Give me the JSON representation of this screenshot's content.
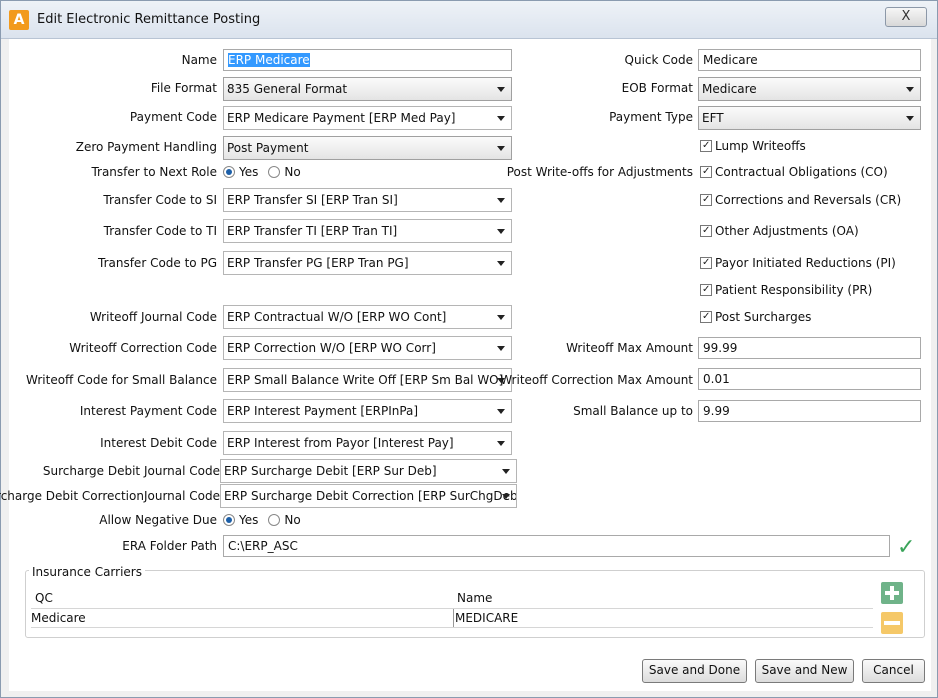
{
  "window": {
    "title": "Edit Electronic Remittance Posting",
    "close_label": "X"
  },
  "labels": {
    "name": "Name",
    "file_format": "File Format",
    "payment_code": "Payment Code",
    "zero_payment": "Zero Payment Handling",
    "transfer_next_role": "Transfer to Next Role",
    "transfer_si": "Transfer Code to SI",
    "transfer_ti": "Transfer Code to TI",
    "transfer_pg": "Transfer Code to PG",
    "writeoff_journal": "Writeoff Journal Code",
    "writeoff_correction": "Writeoff Correction Code",
    "writeoff_small": "Writeoff Code for Small Balance",
    "interest_payment": "Interest Payment Code",
    "interest_debit": "Interest Debit Code",
    "surcharge_debit": "Surcharge Debit Journal Code",
    "surcharge_correction": "Surcharge Debit CorrectionJournal Code",
    "allow_negative": "Allow Negative Due",
    "era_folder": "ERA Folder Path",
    "quick_code": "Quick Code",
    "eob_format": "EOB Format",
    "payment_type": "Payment Type",
    "post_writeoffs": "Post Write-offs for Adjustments",
    "writeoff_max": "Writeoff Max Amount",
    "writeoff_corr_max": "Writeoff Correction Max Amount",
    "small_balance": "Small Balance up to"
  },
  "values": {
    "name": "ERP Medicare",
    "file_format": "835 General Format",
    "payment_code": "ERP Medicare Payment  [ERP Med Pay]",
    "zero_payment": "Post Payment",
    "transfer_si": "ERP Transfer SI  [ERP Tran SI]",
    "transfer_ti": "ERP Transfer TI  [ERP Tran TI]",
    "transfer_pg": "ERP Transfer PG  [ERP Tran PG]",
    "writeoff_journal": "ERP Contractual W/O  [ERP WO Cont]",
    "writeoff_correction": "ERP Correction W/O  [ERP WO Corr]",
    "writeoff_small": "ERP Small Balance Write Off  [ERP Sm Bal WO]",
    "interest_payment": "ERP Interest Payment  [ERPInPa]",
    "interest_debit": "ERP Interest from Payor  [Interest Pay]",
    "surcharge_debit": "ERP Surcharge Debit  [ERP Sur Deb]",
    "surcharge_correction": "ERP Surcharge Debit Correction  [ERP SurChgDebCr]",
    "era_folder": "C:\\ERP_ASC",
    "quick_code": "Medicare",
    "eob_format": "Medicare",
    "payment_type": "EFT",
    "writeoff_max": "99.99",
    "writeoff_corr_max": "0.01",
    "small_balance": "9.99"
  },
  "radios": {
    "yes": "Yes",
    "no": "No"
  },
  "checks": {
    "lump": "Lump Writeoffs",
    "co": "Contractual Obligations (CO)",
    "cr": "Corrections and Reversals (CR)",
    "oa": "Other Adjustments (OA)",
    "pi": "Payor Initiated Reductions (PI)",
    "pr": "Patient Responsibility (PR)",
    "surcharges": "Post Surcharges"
  },
  "carriers": {
    "title": "Insurance Carriers",
    "columns": [
      "QC",
      "Name"
    ],
    "rows": [
      [
        "Medicare",
        "MEDICARE"
      ]
    ]
  },
  "buttons": {
    "save_done": "Save and Done",
    "save_new": "Save and New",
    "cancel": "Cancel"
  }
}
